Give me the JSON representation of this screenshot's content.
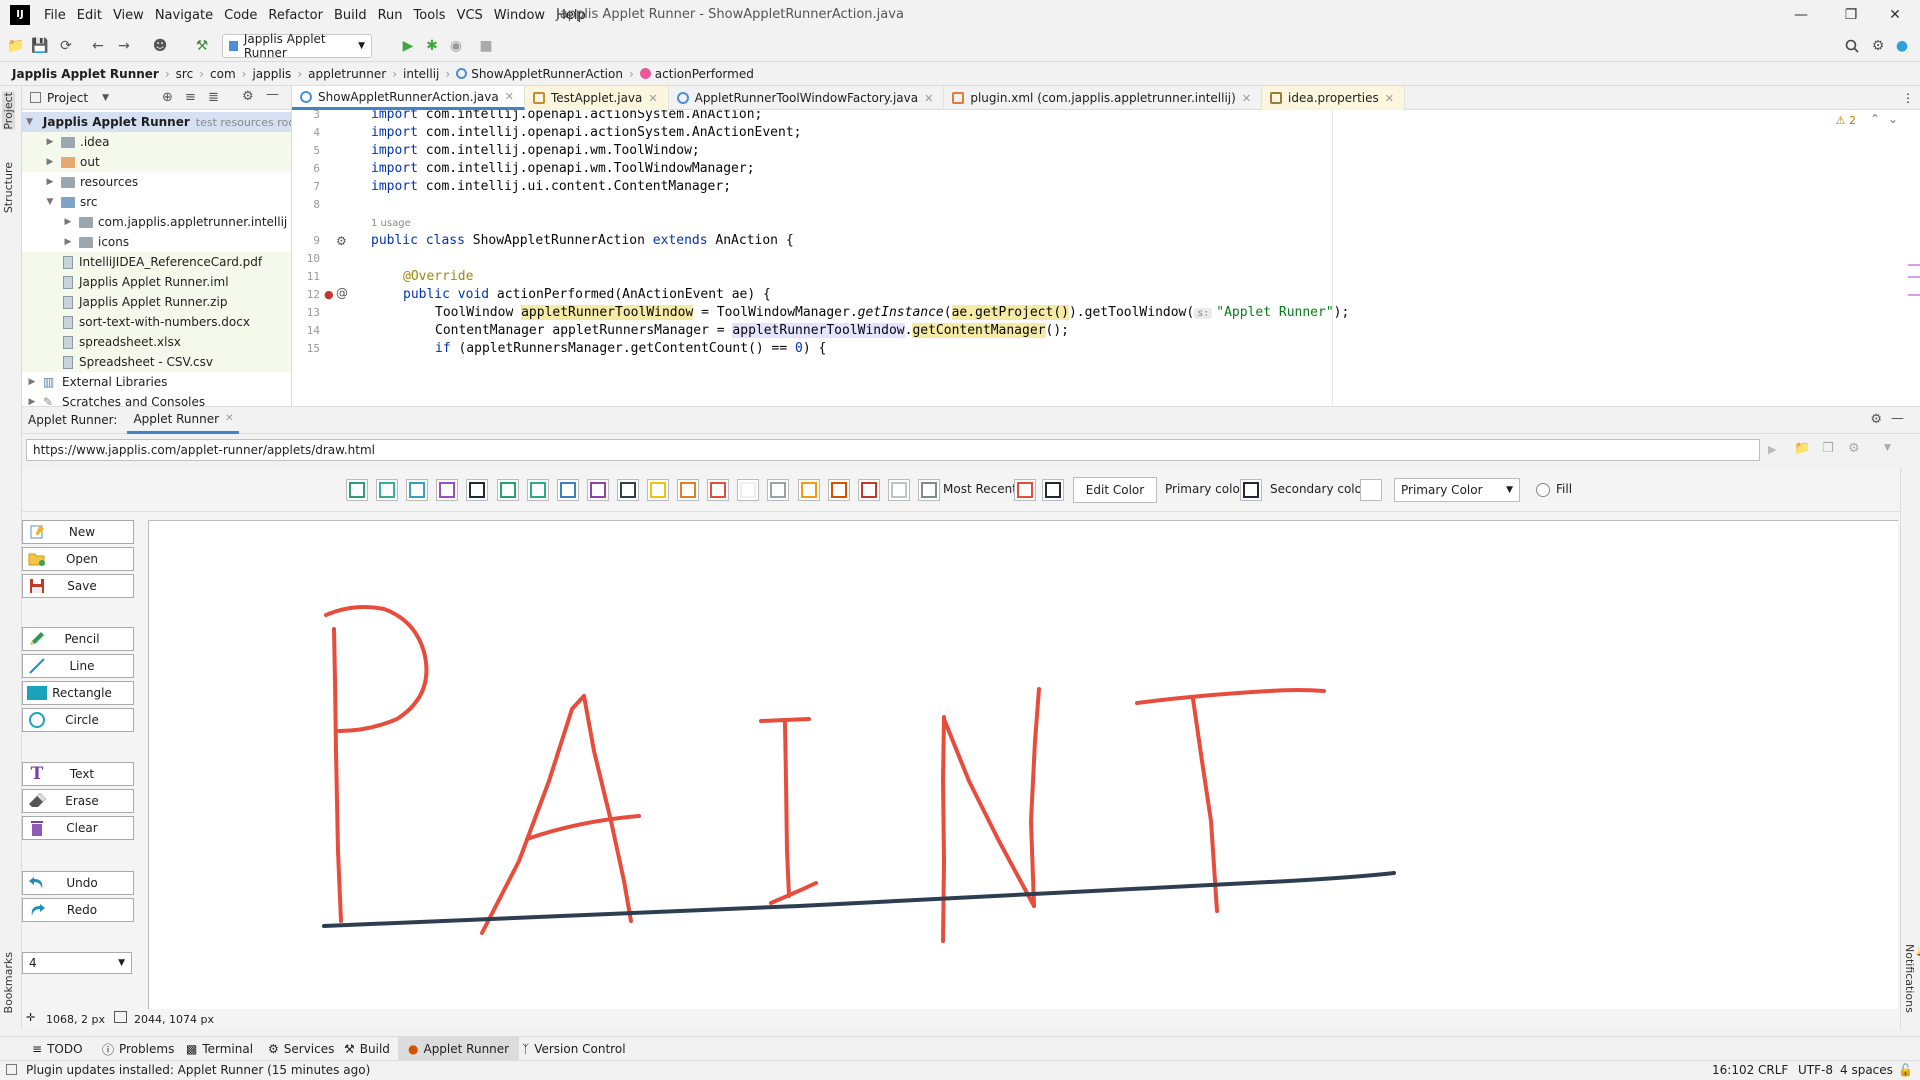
{
  "window": {
    "logo_text": "IJ",
    "title": "Japplis Applet Runner - ShowAppletRunnerAction.java",
    "menu": [
      "File",
      "Edit",
      "View",
      "Navigate",
      "Code",
      "Refactor",
      "Build",
      "Run",
      "Tools",
      "VCS",
      "Window",
      "Help"
    ]
  },
  "toolbar": {
    "run_config": "Japplis Applet Runner"
  },
  "breadcrumbs": [
    "Japplis Applet Runner",
    "src",
    "com",
    "japplis",
    "appletrunner",
    "intellij",
    "ShowAppletRunnerAction",
    "actionPerformed"
  ],
  "left_strip": {
    "project": "Project",
    "structure": "Structure",
    "bookmarks": "Bookmarks"
  },
  "project": {
    "header": "Project",
    "root_label": "Japplis Applet Runner",
    "root_hint": "test resources root,",
    "items": [
      {
        "label": ".idea",
        "kind": "folder"
      },
      {
        "label": "out",
        "kind": "folder-orange"
      },
      {
        "label": "resources",
        "kind": "folder"
      },
      {
        "label": "src",
        "kind": "folder-blue"
      },
      {
        "label": "com.japplis.appletrunner.intellij",
        "kind": "folder"
      },
      {
        "label": "icons",
        "kind": "folder"
      },
      {
        "label": "IntelliJIDEA_ReferenceCard.pdf",
        "kind": "file"
      },
      {
        "label": "Japplis Applet Runner.iml",
        "kind": "file"
      },
      {
        "label": "Japplis Applet Runner.zip",
        "kind": "file"
      },
      {
        "label": "sort-text-with-numbers.docx",
        "kind": "file"
      },
      {
        "label": "spreadsheet.xlsx",
        "kind": "file"
      },
      {
        "label": "Spreadsheet - CSV.csv",
        "kind": "file"
      },
      {
        "label": "External Libraries",
        "kind": "lib"
      },
      {
        "label": "Scratches and Consoles",
        "kind": "scratch"
      }
    ]
  },
  "editor": {
    "tabs": [
      "ShowAppletRunnerAction.java",
      "TestApplet.java",
      "AppletRunnerToolWindowFactory.java",
      "plugin.xml (com.japplis.appletrunner.intellij)",
      "idea.properties"
    ],
    "warnings": "2",
    "usage": "1 usage",
    "line_numbers": [
      "3",
      "4",
      "5",
      "6",
      "7",
      "8",
      "9",
      "10",
      "11",
      "12",
      "13",
      "14",
      "15"
    ],
    "import_kw": "import",
    "imports": [
      "com.intellij.openapi.actionSystem.AnAction;",
      "com.intellij.openapi.actionSystem.AnActionEvent;",
      "com.intellij.openapi.wm.ToolWindow;",
      "com.intellij.openapi.wm.ToolWindowManager;",
      "com.intellij.ui.content.ContentManager;"
    ],
    "class_kw1": "public class",
    "class_name": " ShowAppletRunnerAction ",
    "class_kw2": "extends",
    "class_rest": " AnAction {",
    "override": "@Override",
    "method_kw": "public void",
    "method_rest": " actionPerformed(AnActionEvent ae) {",
    "l13_a": "ToolWindow ",
    "l13_var": "appletRunnerToolWindow",
    "l13_b": " = ToolWindowManager.",
    "l13_it": "getInstance",
    "l13_c": "(",
    "l13_proj": "ae.getProject()",
    "l13_d": ").getToolWindow(",
    "l13_hint": "s:",
    "l13_str": "\"Applet Runner\"",
    "l13_e": ");",
    "l14_a": "ContentManager appletRunnersManager = ",
    "l14_var": "appletRunnerToolWindow",
    "l14_b": ".",
    "l14_m": "getContentManager",
    "l14_c": "();",
    "l15_kw": "if",
    "l15_rest": " (appletRunnersManager.getContentCount() == ",
    "l15_num": "0",
    "l15_end": ") {"
  },
  "tool_window": {
    "label": "Applet Runner:",
    "tab": "Applet Runner",
    "url": "https://www.japplis.com/applet-runner/applets/draw.html"
  },
  "paint": {
    "swatch_colors": [
      "#2e9e7a",
      "#36b08e",
      "#3aa0c0",
      "#9b4fc0",
      "#1e2a3a",
      "#27a070",
      "#2aaa88",
      "#3b80c0",
      "#8e44ad",
      "#2c3e50",
      "#f1c40f",
      "#e67e22",
      "#e74c3c",
      "#ecf0f1",
      "#95a5a6",
      "#f39c12",
      "#d35400",
      "#c0392b",
      "#bdc3c7",
      "#7f8c8d"
    ],
    "most_recent_label": "Most Recent",
    "recent_colors": [
      "#e74c3c",
      "#1e2a3a"
    ],
    "edit_color": "Edit Color",
    "primary_label": "Primary color",
    "primary_value": "#1e2a3a",
    "secondary_label": "Secondary color",
    "secondary_value": "#ffffff",
    "color_select": "Primary Color",
    "fill_label": "Fill",
    "buttons": {
      "new": "New",
      "open": "Open",
      "save": "Save",
      "pencil": "Pencil",
      "line": "Line",
      "rectangle": "Rectangle",
      "circle": "Circle",
      "text": "Text",
      "erase": "Erase",
      "clear": "Clear",
      "undo": "Undo",
      "redo": "Redo"
    },
    "size_value": "4",
    "stroke_red": "#e74c3c",
    "stroke_dark": "#2c3e50"
  },
  "coords": {
    "position": "1068,  2 px",
    "size": "2044,  1074 px"
  },
  "bottom_tabs": [
    "TODO",
    "Problems",
    "Terminal",
    "Services",
    "Build",
    "Applet Runner",
    "Version Control"
  ],
  "notifications_label": "Notifications",
  "status": {
    "message": "Plugin updates installed: Applet Runner (15 minutes ago)",
    "position": "16:102",
    "line_sep": "CRLF",
    "encoding": "UTF-8",
    "indent": "4 spaces"
  }
}
